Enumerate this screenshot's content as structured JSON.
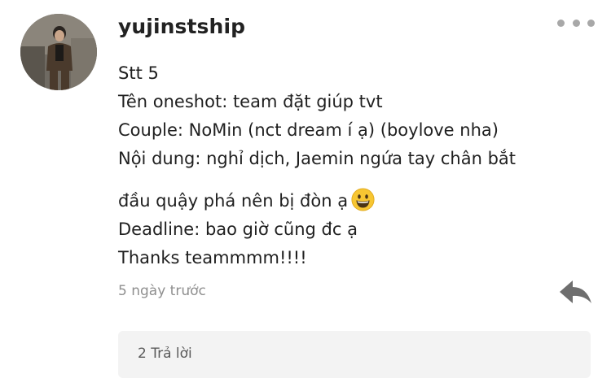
{
  "comment": {
    "username": "yujinstship",
    "lines": [
      "Stt 5",
      "Tên oneshot: team đặt giúp tvt",
      "Couple: NoMin (nct dream í ạ) (boylove nha)",
      "Nội dung: nghỉ dịch, Jaemin ngứa tay chân bắt",
      "đầu quậy phá nên bị đòn ạ",
      "Deadline: bao giờ cũng đc ạ",
      "Thanks teammmm!!!!"
    ],
    "timestamp": "5 ngày trước",
    "replies_label": "2 Trả lời"
  },
  "icons": {
    "more": "more-dots-icon",
    "reply": "reply-arrow-icon",
    "emoji": "grinning-face-emoji"
  },
  "colors": {
    "username": "#222222",
    "body_text": "#1f1f1f",
    "muted": "#8f8f8f",
    "replies_bg": "#f3f3f3",
    "reply_icon": "#6e6e6e"
  }
}
